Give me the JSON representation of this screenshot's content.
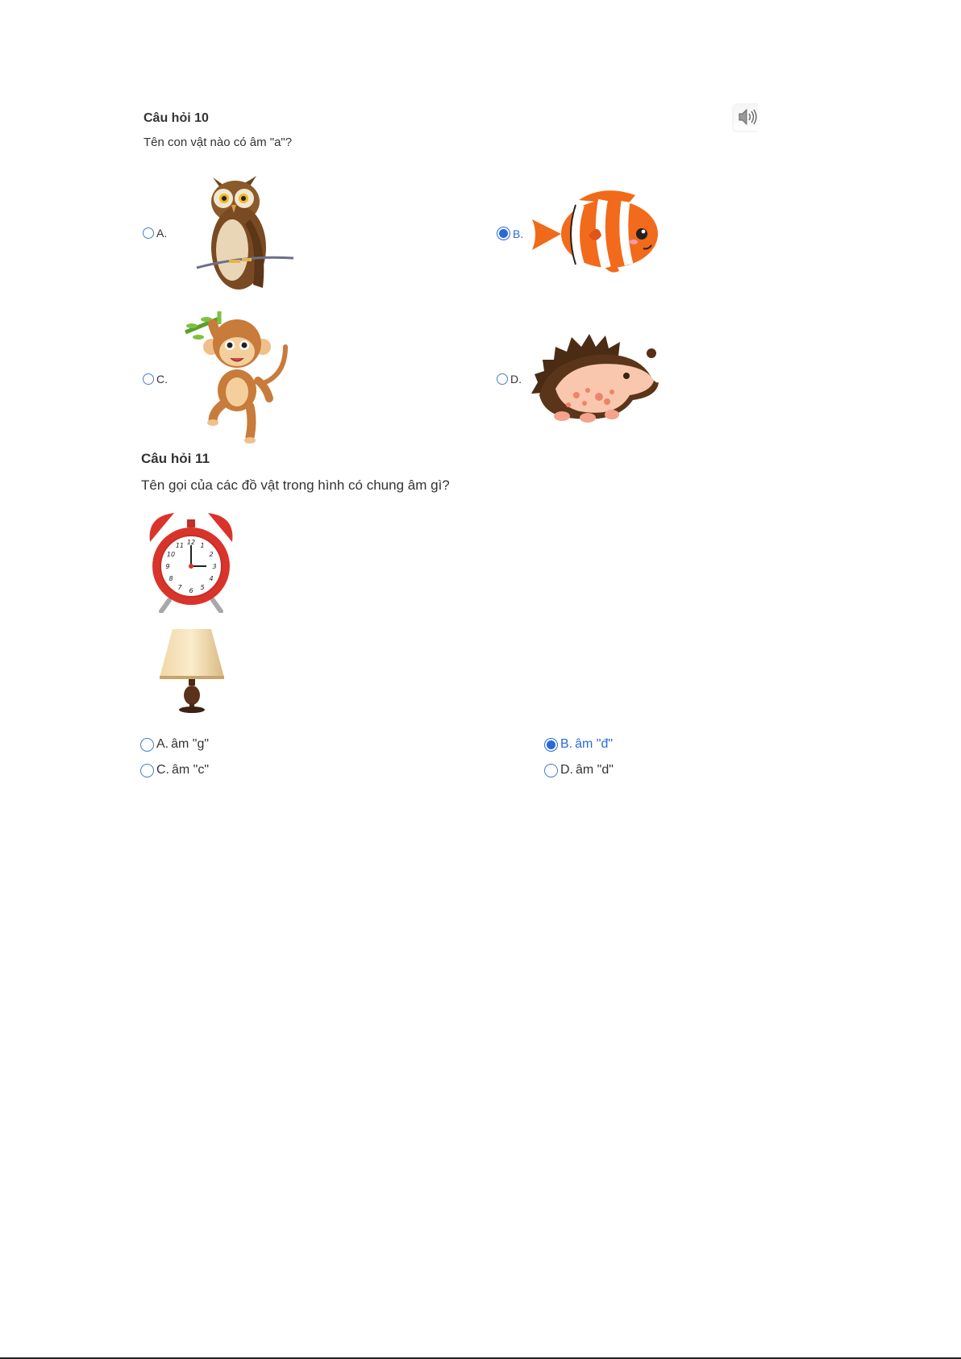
{
  "q10": {
    "title": "Câu hỏi 10",
    "question": "Tên con vật nào có âm \"a\"?",
    "options": [
      {
        "label": "A.",
        "image": "owl",
        "selected": false
      },
      {
        "label": "B.",
        "image": "clownfish",
        "selected": true
      },
      {
        "label": "C.",
        "image": "monkey",
        "selected": false
      },
      {
        "label": "D.",
        "image": "hedgehog",
        "selected": false
      }
    ]
  },
  "q11": {
    "title": "Câu hỏi 11",
    "question": "Tên gọi của các đồ vật trong hình có chung âm gì?",
    "images": [
      "alarm-clock",
      "table-lamp"
    ],
    "options": [
      {
        "label": "A.",
        "text": "âm \"g\"",
        "selected": false
      },
      {
        "label": "B.",
        "text": "âm \"đ\"",
        "selected": true
      },
      {
        "label": "C.",
        "text": "âm \"c\"",
        "selected": false
      },
      {
        "label": "D.",
        "text": "âm \"d\"",
        "selected": false
      }
    ]
  },
  "icons": {
    "audio": "speaker-icon"
  },
  "colors": {
    "accent": "#2a6ad8",
    "text": "#333333"
  }
}
